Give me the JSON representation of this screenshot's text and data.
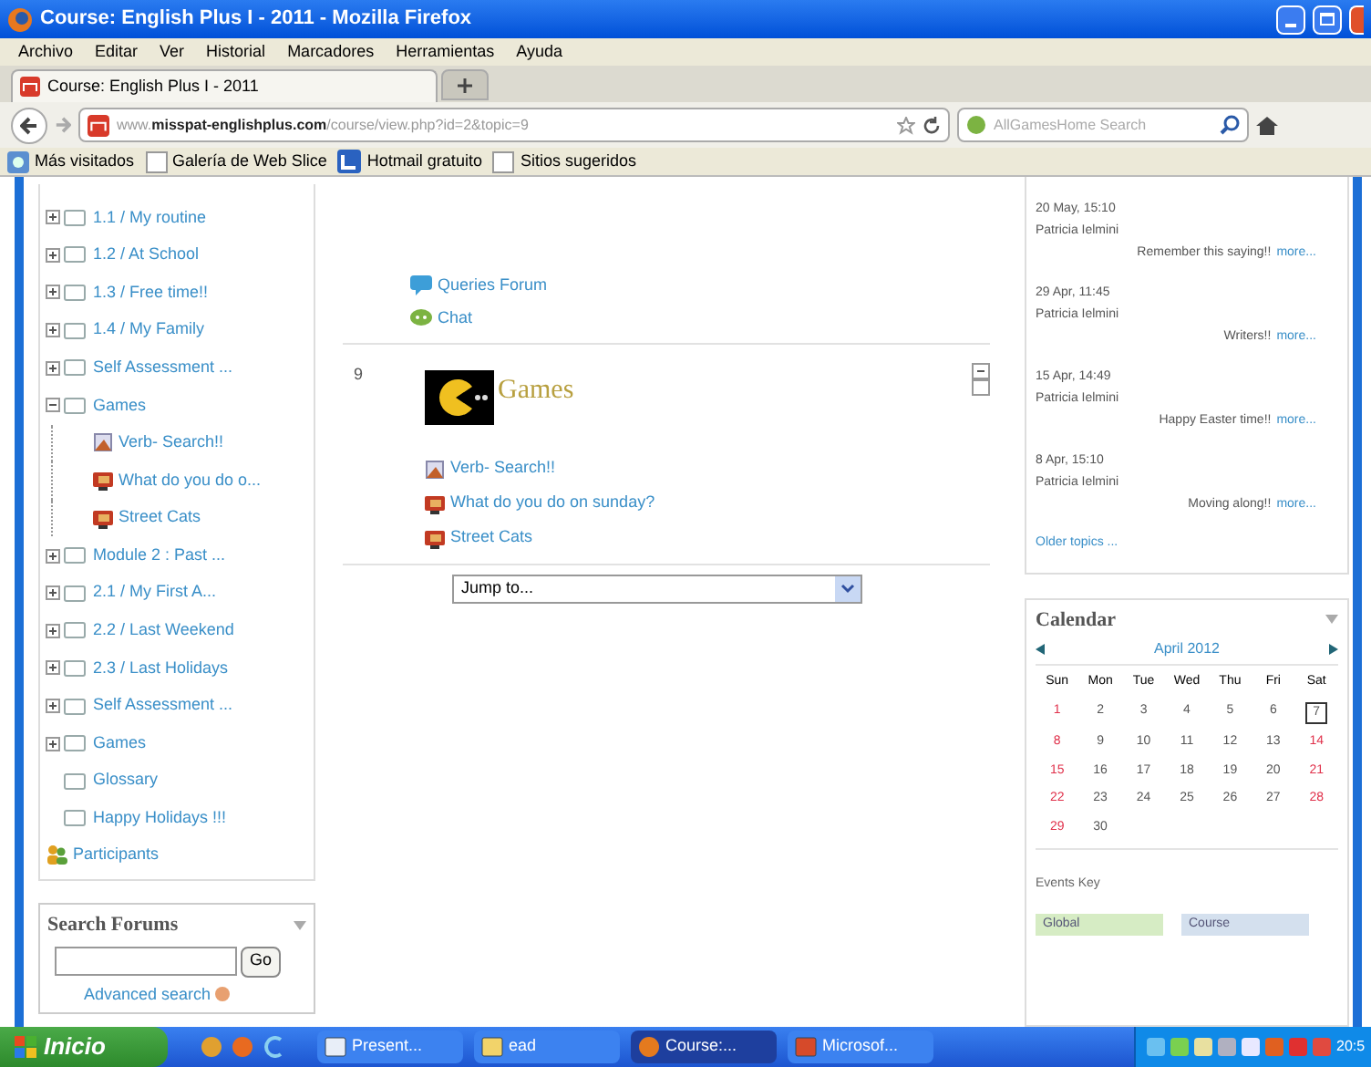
{
  "window": {
    "title": "Course: English Plus I - 2011 - Mozilla Firefox"
  },
  "menu": [
    "Archivo",
    "Editar",
    "Ver",
    "Historial",
    "Marcadores",
    "Herramientas",
    "Ayuda"
  ],
  "tabs": [
    {
      "label": "Course: English Plus I - 2011",
      "selected": true
    }
  ],
  "address": {
    "value": "www.**misspat-englishplus.com**/course/view.php?id=2&topic=9"
  },
  "search": {
    "placeholder": "AllGamesHome Search"
  },
  "bookmarks": [
    {
      "label": "Más visitados",
      "kind": "feed"
    },
    {
      "label": "Galería de Web Slice",
      "kind": "page"
    },
    {
      "label": "Hotmail gratuito",
      "kind": "mail"
    },
    {
      "label": "Sitios sugeridos",
      "kind": "page"
    }
  ],
  "tree": [
    {
      "label": "1.1 / My routine",
      "kind": "section",
      "expanded": false
    },
    {
      "label": "1.2 / At School",
      "kind": "section",
      "expanded": false
    },
    {
      "label": "1.3 / Free time!!",
      "kind": "section",
      "expanded": false
    },
    {
      "label": "1.4 / My Family",
      "kind": "section",
      "expanded": false
    },
    {
      "label": "Self Assessment ...",
      "kind": "section",
      "expanded": false
    },
    {
      "label": "Games",
      "kind": "section",
      "expanded": true,
      "children": [
        {
          "label": "Verb- Search!!",
          "kind": "quiz"
        },
        {
          "label": "What do you do o...",
          "kind": "activity"
        },
        {
          "label": "Street Cats",
          "kind": "activity"
        }
      ]
    },
    {
      "label": "Module 2 : Past ...",
      "kind": "section",
      "expanded": false
    },
    {
      "label": "2.1 / My First A...",
      "kind": "section",
      "expanded": false
    },
    {
      "label": "2.2 / Last Weekend",
      "kind": "section",
      "expanded": false
    },
    {
      "label": "2.3 / Last Holidays",
      "kind": "section",
      "expanded": false
    },
    {
      "label": "Self Assessment ...",
      "kind": "section",
      "expanded": false
    },
    {
      "label": "Games",
      "kind": "section",
      "expanded": false
    },
    {
      "label": "Glossary",
      "kind": "plain"
    },
    {
      "label": "Happy Holidays !!!",
      "kind": "plain"
    }
  ],
  "participants": "Participants",
  "search_forums": {
    "title": "Search Forums",
    "button": "Go",
    "link": "Advanced search"
  },
  "center": {
    "resources": [
      {
        "label": "Queries Forum",
        "kind": "forum"
      },
      {
        "label": "Chat",
        "kind": "chat"
      }
    ],
    "section": {
      "number": "9",
      "title": "Games",
      "items": [
        {
          "label": "Verb- Search!!",
          "kind": "quiz"
        },
        {
          "label": "What do you do on sunday?",
          "kind": "activity"
        },
        {
          "label": "Street Cats",
          "kind": "activity"
        }
      ]
    },
    "jump": "Jump to..."
  },
  "news": [
    {
      "date": "20 May, 15:10",
      "author": "Patricia Ielmini",
      "text": "Remember this saying!!",
      "link": "more..."
    },
    {
      "date": "29 Apr, 11:45",
      "author": "Patricia Ielmini",
      "text": "Writers!!",
      "link": "more..."
    },
    {
      "date": "15 Apr, 14:49",
      "author": "Patricia Ielmini",
      "text": "Happy Easter time!!",
      "link": "more..."
    },
    {
      "date": "8 Apr, 15:10",
      "author": "Patricia Ielmini",
      "text": "Moving along!!",
      "link": "more..."
    }
  ],
  "older_topics": "Older topics ...",
  "calendar": {
    "title": "Calendar",
    "month": "April 2012",
    "weekdays": [
      "Sun",
      "Mon",
      "Tue",
      "Wed",
      "Thu",
      "Fri",
      "Sat"
    ],
    "weeks": [
      [
        {
          "day": "1",
          "weekend": true
        },
        {
          "day": "2",
          "weekend": false
        },
        {
          "day": "3",
          "weekend": false
        },
        {
          "day": "4",
          "weekend": false
        },
        {
          "day": "5",
          "weekend": false
        },
        {
          "day": "6",
          "weekend": false
        },
        {
          "day": "7",
          "weekend": false,
          "today": true
        }
      ],
      [
        {
          "day": "8",
          "weekend": true
        },
        {
          "day": "9",
          "weekend": false
        },
        {
          "day": "10",
          "weekend": false
        },
        {
          "day": "11",
          "weekend": false
        },
        {
          "day": "12",
          "weekend": false
        },
        {
          "day": "13",
          "weekend": false
        },
        {
          "day": "14",
          "weekend": true
        }
      ],
      [
        {
          "day": "15",
          "weekend": true
        },
        {
          "day": "16",
          "weekend": false
        },
        {
          "day": "17",
          "weekend": false
        },
        {
          "day": "18",
          "weekend": false
        },
        {
          "day": "19",
          "weekend": false
        },
        {
          "day": "20",
          "weekend": false
        },
        {
          "day": "21",
          "weekend": true
        }
      ],
      [
        {
          "day": "22",
          "weekend": true
        },
        {
          "day": "23",
          "weekend": false
        },
        {
          "day": "24",
          "weekend": false
        },
        {
          "day": "25",
          "weekend": false
        },
        {
          "day": "26",
          "weekend": false
        },
        {
          "day": "27",
          "weekend": false
        },
        {
          "day": "28",
          "weekend": true
        }
      ],
      [
        {
          "day": "29",
          "weekend": true
        },
        {
          "day": "30",
          "weekend": false
        }
      ]
    ],
    "events_key": "Events Key",
    "event_types": [
      {
        "label": "Global",
        "color": "#d6ecc4"
      },
      {
        "label": "Course",
        "color": "#d4e0ee"
      }
    ]
  },
  "taskbar": {
    "start": "Inicio",
    "tasks": [
      {
        "label": "Present...",
        "kind": "doc",
        "selected": false
      },
      {
        "label": "ead",
        "kind": "folder",
        "selected": false
      },
      {
        "label": "Course:...",
        "kind": "browser",
        "selected": true
      },
      {
        "label": "Microsof...",
        "kind": "office",
        "selected": false
      }
    ],
    "clock": "20:5"
  }
}
